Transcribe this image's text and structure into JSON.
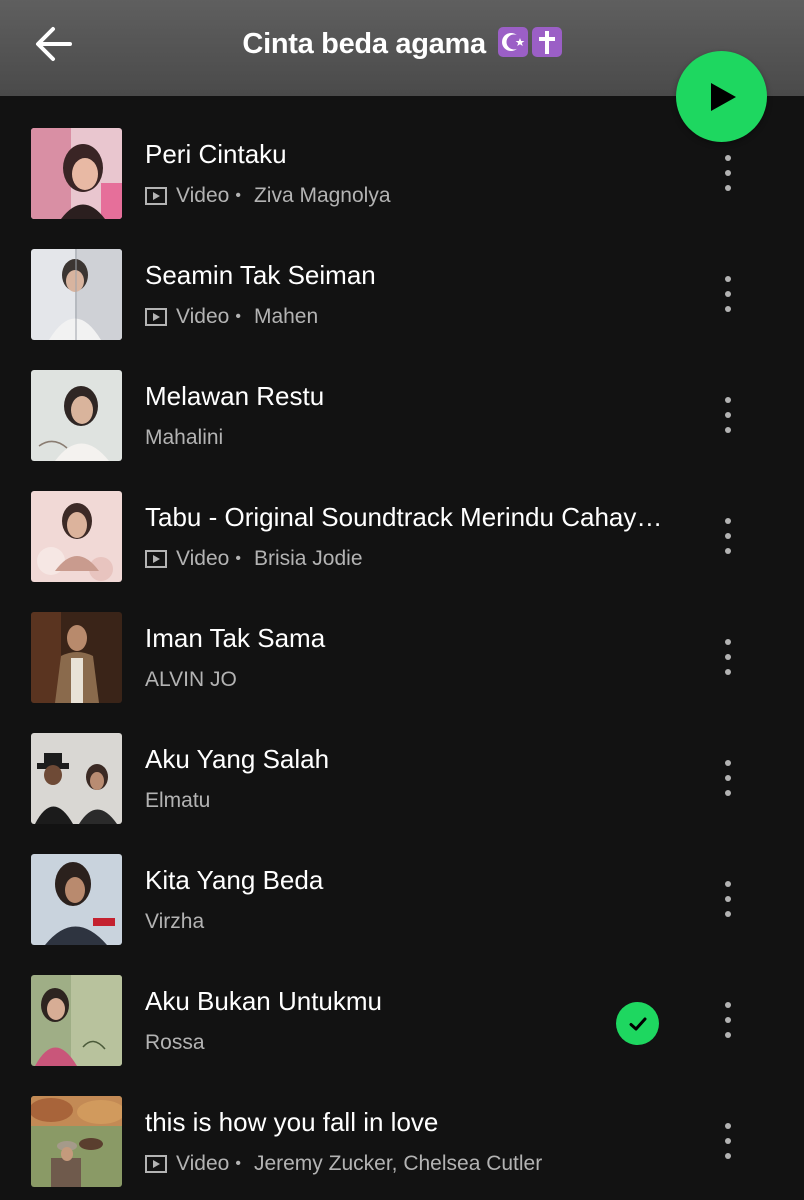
{
  "header": {
    "title": "Cinta beda agama",
    "title_emojis": [
      "star-and-crescent-icon",
      "latin-cross-icon"
    ],
    "back_icon": "arrow-left-icon",
    "play_icon": "play-icon"
  },
  "colors": {
    "background": "#121212",
    "header": "#555555",
    "accent": "#1ed760",
    "secondary_text": "#b3b3b3",
    "emoji_box": "#9b5fc6"
  },
  "tracks": [
    {
      "title": "Peri Cintaku",
      "video_label": "Video",
      "artist": "Ziva Magnolya",
      "is_video": true,
      "saved": false
    },
    {
      "title": "Seamin Tak Seiman",
      "video_label": "Video",
      "artist": "Mahen",
      "is_video": true,
      "saved": false
    },
    {
      "title": "Melawan Restu",
      "video_label": "",
      "artist": "Mahalini",
      "is_video": false,
      "saved": false
    },
    {
      "title": "Tabu - Original Soundtrack Merindu Cahaya de Amstel",
      "video_label": "Video",
      "artist": "Brisia Jodie",
      "is_video": true,
      "saved": false
    },
    {
      "title": "Iman Tak Sama",
      "video_label": "",
      "artist": "ALVIN JO",
      "is_video": false,
      "saved": false
    },
    {
      "title": "Aku Yang Salah",
      "video_label": "",
      "artist": "Elmatu",
      "is_video": false,
      "saved": false
    },
    {
      "title": "Kita Yang Beda",
      "video_label": "",
      "artist": "Virzha",
      "is_video": false,
      "saved": false
    },
    {
      "title": "Aku Bukan Untukmu",
      "video_label": "",
      "artist": "Rossa",
      "is_video": false,
      "saved": true
    },
    {
      "title": "this is how you fall in love",
      "video_label": "Video",
      "artist": "Jeremy Zucker, Chelsea Cutler",
      "is_video": true,
      "saved": false
    }
  ]
}
